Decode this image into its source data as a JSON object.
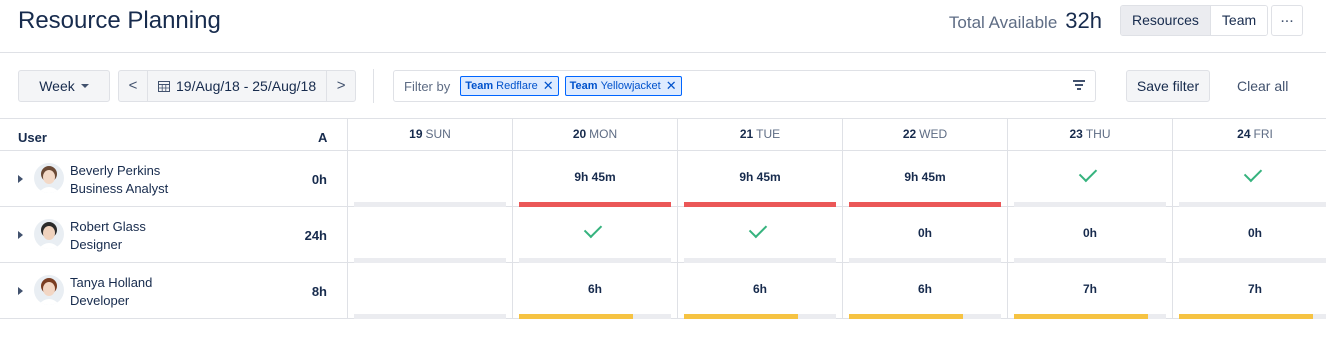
{
  "header": {
    "title": "Resource Planning",
    "total_label": "Total Available",
    "total_value": "32h",
    "view_toggle": [
      "Resources",
      "Team"
    ],
    "more": "..."
  },
  "toolbar": {
    "week_label": "Week",
    "prev": "<",
    "next": ">",
    "date_range": "19/Aug/18 - 25/Aug/18",
    "filter_label": "Filter by",
    "chips": [
      {
        "prefix": "Team",
        "value": "Redflare"
      },
      {
        "prefix": "Team",
        "value": "Yellowjacket"
      }
    ],
    "save_filter": "Save filter",
    "clear_all": "Clear all"
  },
  "grid": {
    "user_header": "User",
    "avail_header": "A",
    "days": [
      {
        "num": "19",
        "name": "SUN"
      },
      {
        "num": "20",
        "name": "MON"
      },
      {
        "num": "21",
        "name": "TUE"
      },
      {
        "num": "22",
        "name": "WED"
      },
      {
        "num": "23",
        "name": "THU"
      },
      {
        "num": "24",
        "name": "FRI"
      }
    ],
    "rows": [
      {
        "name": "Beverly Perkins",
        "role": "Business Analyst",
        "available": "0h",
        "cells": [
          {
            "kind": "empty",
            "fill": 0,
            "color": "#ebecf0"
          },
          {
            "kind": "text",
            "text": "9h 45m",
            "fill": 1.0,
            "color": "#eb5757"
          },
          {
            "kind": "text",
            "text": "9h 45m",
            "fill": 1.0,
            "color": "#eb5757"
          },
          {
            "kind": "text",
            "text": "9h 45m",
            "fill": 1.0,
            "color": "#eb5757"
          },
          {
            "kind": "check",
            "fill": 0,
            "color": "#ebecf0"
          },
          {
            "kind": "check",
            "fill": 0,
            "color": "#ebecf0"
          }
        ]
      },
      {
        "name": "Robert Glass",
        "role": "Designer",
        "available": "24h",
        "cells": [
          {
            "kind": "empty",
            "fill": 0,
            "color": "#ebecf0"
          },
          {
            "kind": "check",
            "fill": 0,
            "color": "#ebecf0"
          },
          {
            "kind": "check",
            "fill": 0,
            "color": "#ebecf0"
          },
          {
            "kind": "text",
            "text": "0h",
            "fill": 0,
            "color": "#ebecf0"
          },
          {
            "kind": "text",
            "text": "0h",
            "fill": 0,
            "color": "#ebecf0"
          },
          {
            "kind": "text",
            "text": "0h",
            "fill": 0,
            "color": "#ebecf0"
          }
        ]
      },
      {
        "name": "Tanya Holland",
        "role": "Developer",
        "available": "8h",
        "cells": [
          {
            "kind": "empty",
            "fill": 0,
            "color": "#ebecf0"
          },
          {
            "kind": "text",
            "text": "6h",
            "fill": 0.75,
            "color": "#f6c342"
          },
          {
            "kind": "text",
            "text": "6h",
            "fill": 0.75,
            "color": "#f6c342"
          },
          {
            "kind": "text",
            "text": "6h",
            "fill": 0.75,
            "color": "#f6c342"
          },
          {
            "kind": "text",
            "text": "7h",
            "fill": 0.88,
            "color": "#f6c342"
          },
          {
            "kind": "text",
            "text": "7h",
            "fill": 0.88,
            "color": "#f6c342"
          }
        ]
      }
    ]
  },
  "colors": {
    "over": "#eb5757",
    "partial": "#f6c342",
    "check": "#36b37e",
    "chip_border": "#0065ff"
  }
}
